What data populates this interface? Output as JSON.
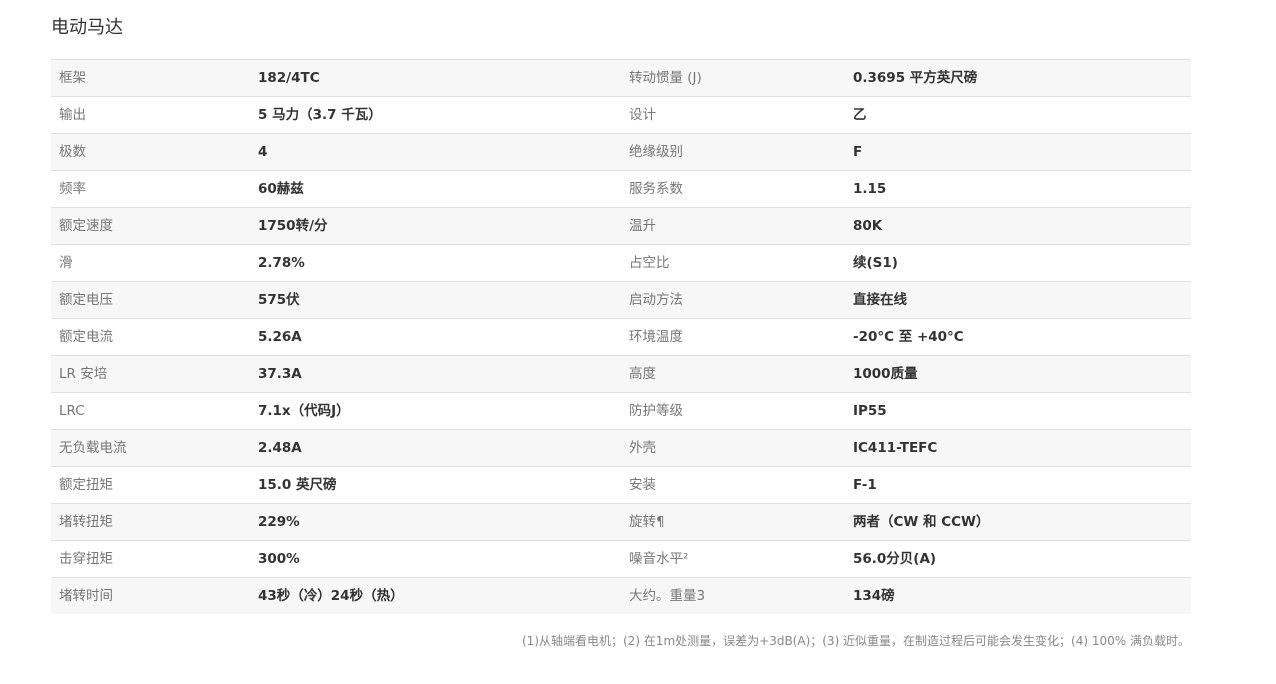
{
  "title": "电动马达",
  "rows": [
    {
      "label1": "框架",
      "value1": "182/4TC",
      "label2": "转动惯量 (J)",
      "value2": "0.3695 平方英尺磅"
    },
    {
      "label1": "输出",
      "value1": "5 马力（3.7 千瓦）",
      "label2": "设计",
      "value2": "乙"
    },
    {
      "label1": "极数",
      "value1": "4",
      "label2": "绝缘级别",
      "value2": "F"
    },
    {
      "label1": "频率",
      "value1": "60赫兹",
      "label2": "服务系数",
      "value2": "1.15"
    },
    {
      "label1": "额定速度",
      "value1": "1750转/分",
      "label2": "温升",
      "value2": "80K"
    },
    {
      "label1": "滑",
      "value1": "2.78%",
      "label2": "占空比",
      "value2": "续(S1)"
    },
    {
      "label1": "额定电压",
      "value1": "575伏",
      "label2": "启动方法",
      "value2": "直接在线"
    },
    {
      "label1": "额定电流",
      "value1": "5.26A",
      "label2": "环境温度",
      "value2": "-20°C 至 +40°C"
    },
    {
      "label1": "LR 安培",
      "value1": "37.3A",
      "label2": "高度",
      "value2": "1000质量"
    },
    {
      "label1": "LRC",
      "value1": "7.1x（代码J）",
      "label2": "防护等级",
      "value2": "IP55"
    },
    {
      "label1": "无负载电流",
      "value1": "2.48A",
      "label2": "外壳",
      "value2": "IC411-TEFC"
    },
    {
      "label1": "额定扭矩",
      "value1": "15.0 英尺磅",
      "label2": "安装",
      "value2": "F-1"
    },
    {
      "label1": "堵转扭矩",
      "value1": "229%",
      "label2": "旋转¶",
      "value2": "两者（CW 和 CCW）"
    },
    {
      "label1": "击穿扭矩",
      "value1": "300%",
      "label2": "噪音水平²",
      "value2": "56.0分贝(A)"
    },
    {
      "label1": "堵转时间",
      "value1": "43秒（冷）24秒（热）",
      "label2": "大约。重量3",
      "value2": "134磅"
    }
  ],
  "footnote": "(1)从轴端看电机；(2) 在1m处测量，误差为+3dB(A)；(3) 近似重量，在制造过程后可能会发生变化；(4) 100% 满负载时。"
}
